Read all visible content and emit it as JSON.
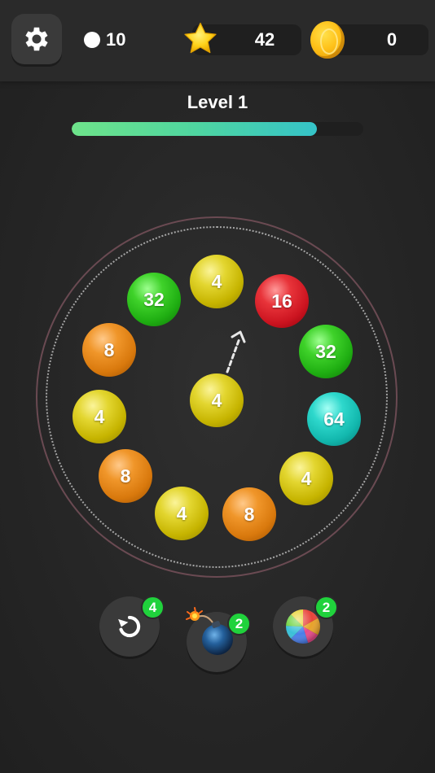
{
  "hud": {
    "balls_left": "10",
    "stars": "42",
    "coins": "0",
    "icons": [
      "gear-icon",
      "ball-icon",
      "star-icon",
      "coin-icon"
    ]
  },
  "level": {
    "title": "Level 1",
    "progress": 0.84
  },
  "board": {
    "ring_balls": [
      {
        "value": "4",
        "color": "yellow"
      },
      {
        "value": "16",
        "color": "red"
      },
      {
        "value": "32",
        "color": "green"
      },
      {
        "value": "64",
        "color": "teal"
      },
      {
        "value": "4",
        "color": "yellow"
      },
      {
        "value": "8",
        "color": "orange"
      },
      {
        "value": "4",
        "color": "yellow"
      },
      {
        "value": "8",
        "color": "orange"
      },
      {
        "value": "4",
        "color": "yellow"
      },
      {
        "value": "8",
        "color": "orange"
      },
      {
        "value": "32",
        "color": "green"
      }
    ],
    "shooter_ball": {
      "value": "4",
      "color": "yellow"
    },
    "aim_direction": "up-right"
  },
  "powerups": {
    "undo_count": "4",
    "bomb_count": "2",
    "rainbow_count": "2"
  },
  "colors": {
    "progress_start": "#6ee38a",
    "progress_end": "#35c3c8",
    "badge": "#20d23c"
  }
}
